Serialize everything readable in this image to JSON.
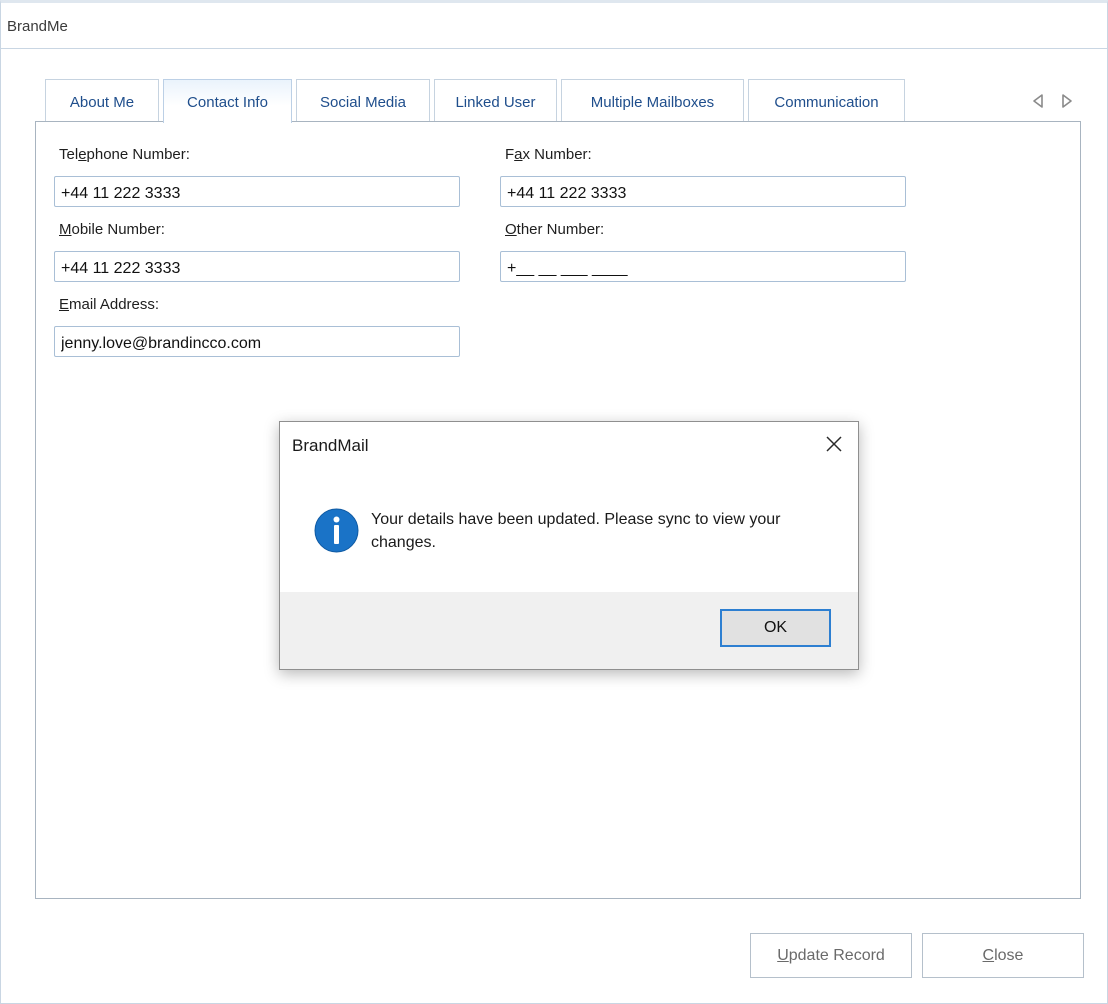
{
  "window": {
    "title": "BrandMe"
  },
  "tabs": [
    {
      "label": "About Me"
    },
    {
      "label": "Contact Info"
    },
    {
      "label": "Social Media"
    },
    {
      "label": "Linked User"
    },
    {
      "label": "Multiple Mailboxes"
    },
    {
      "label": "Communication"
    }
  ],
  "active_tab": "Contact Info",
  "form": {
    "telephone": {
      "label_pre": "Tel",
      "label_key": "e",
      "label_post": "phone Number:",
      "value": "+44 11 222 3333"
    },
    "fax": {
      "label_pre": "F",
      "label_key": "a",
      "label_post": "x Number:",
      "value": "+44 11 222 3333"
    },
    "mobile": {
      "label_pre": "",
      "label_key": "M",
      "label_post": "obile Number:",
      "value": "+44 11 222 3333"
    },
    "other": {
      "label_pre": "",
      "label_key": "O",
      "label_post": "ther Number:",
      "value": "+__ __ ___ ____"
    },
    "email": {
      "label_pre": "",
      "label_key": "E",
      "label_post": "mail Address:",
      "value": "jenny.love@brandincco.com"
    }
  },
  "buttons": {
    "update_key": "U",
    "update_rest": "pdate Record",
    "close_key": "C",
    "close_rest": "lose"
  },
  "dialog": {
    "title": "BrandMail",
    "message": "Your details have been updated. Please sync to view your changes.",
    "ok_label": "OK"
  },
  "colors": {
    "tab_text": "#1f4e8c",
    "info_icon": "#1a73c7",
    "ok_border": "#2d7fd1"
  }
}
